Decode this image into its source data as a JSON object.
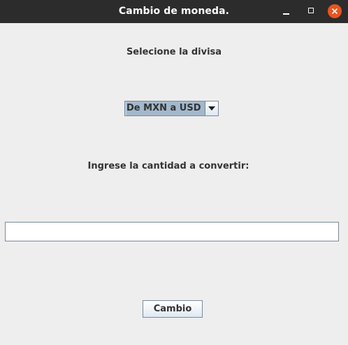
{
  "window": {
    "title": "Cambio de moneda."
  },
  "icons": {
    "minimize": "minimize-icon",
    "maximize": "maximize-icon",
    "close": "close-icon",
    "dropdown": "chevron-down-icon"
  },
  "colors": {
    "titlebar": "#2c2c2c",
    "close_button": "#e95420",
    "background": "#eeeeee",
    "combo_selected": "#a3b8cc"
  },
  "form": {
    "currency_label": "Selecione la divisa",
    "currency_selected": "De MXN a USD",
    "amount_label": "Ingrese la cantidad a convertir:",
    "amount_value": "",
    "submit_label": "Cambio"
  }
}
